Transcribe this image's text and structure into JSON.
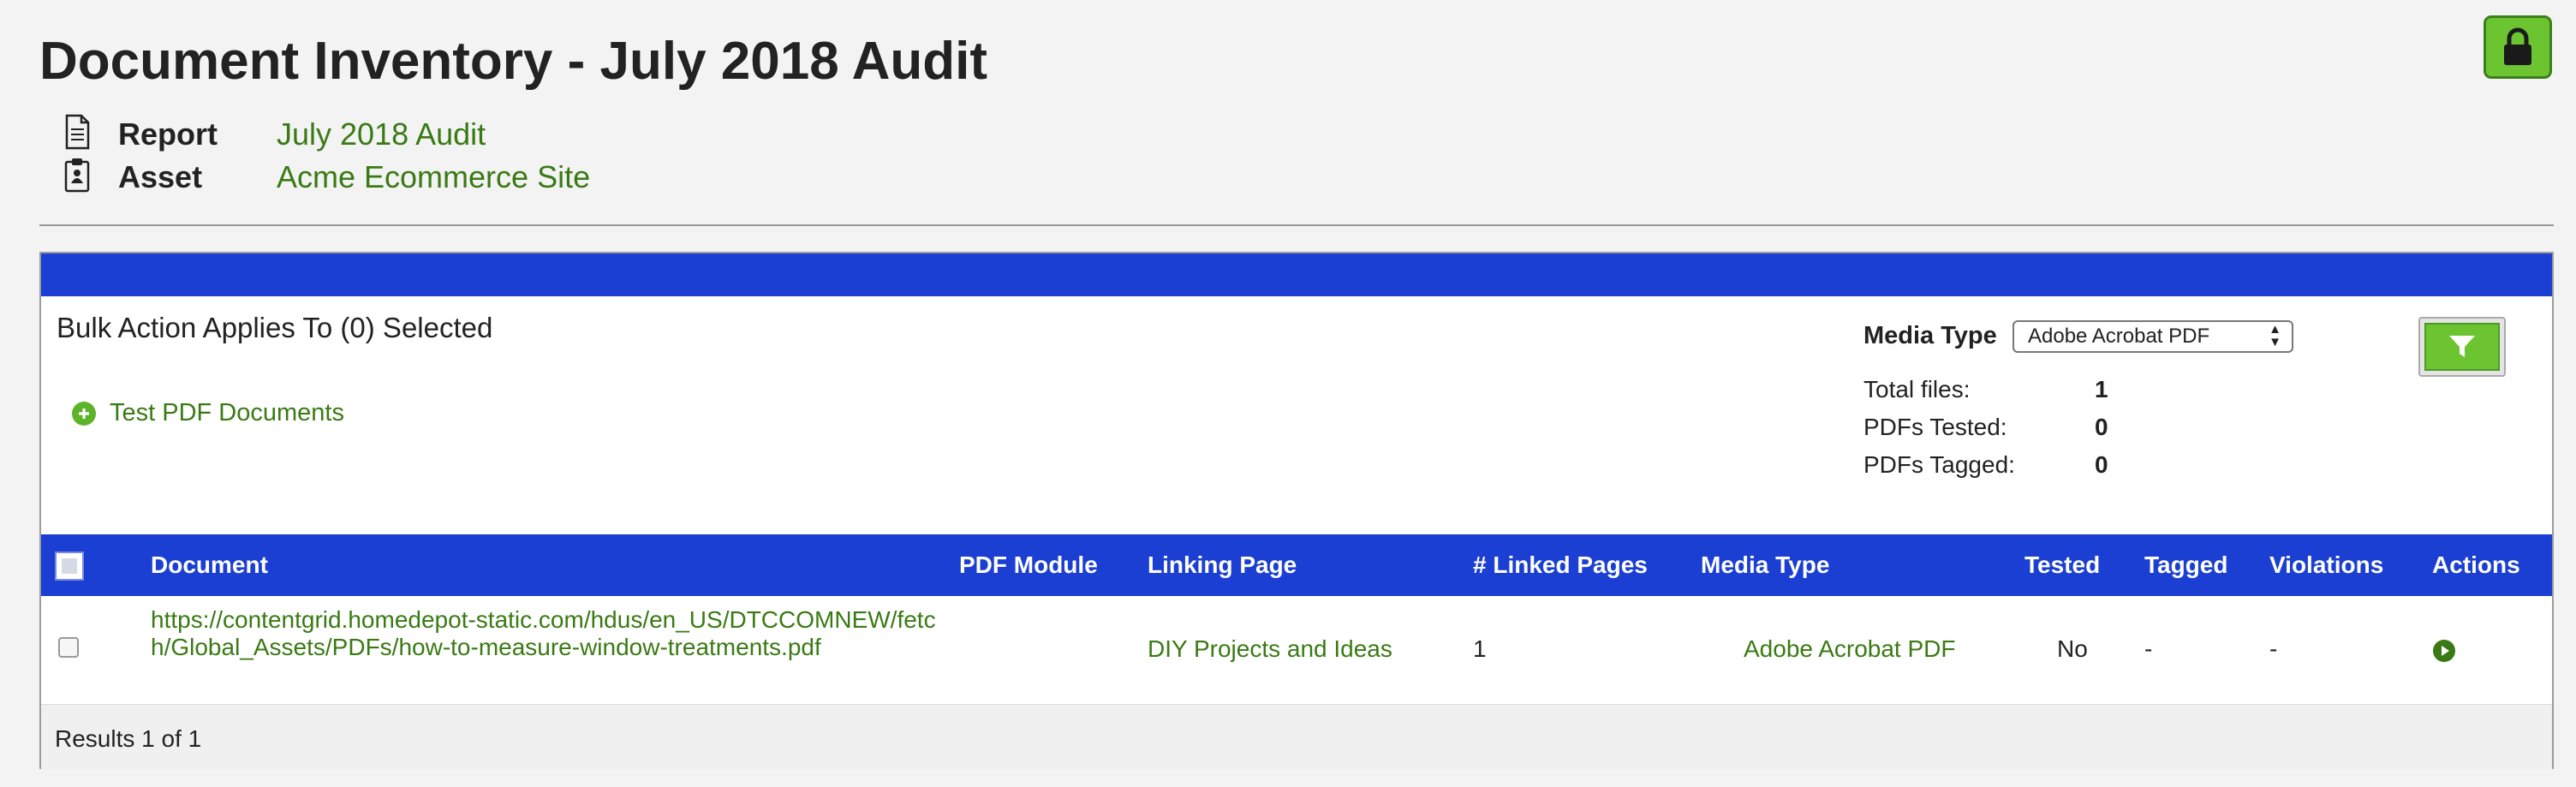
{
  "page": {
    "title": "Document Inventory - July 2018 Audit",
    "report_label": "Report",
    "report_value": "July 2018 Audit",
    "asset_label": "Asset",
    "asset_value": "Acme Ecommerce Site",
    "lock_icon": "lock-icon"
  },
  "toolbar": {
    "bulk_action_text": "Bulk Action Applies To (0) Selected",
    "test_pdf_label": "Test PDF Documents",
    "media_type_label": "Media Type",
    "media_type_selected": "Adobe Acrobat PDF",
    "filter_icon": "filter-icon"
  },
  "stats": {
    "total_files_label": "Total files:",
    "total_files_value": "1",
    "pdfs_tested_label": "PDFs Tested:",
    "pdfs_tested_value": "0",
    "pdfs_tagged_label": "PDFs Tagged:",
    "pdfs_tagged_value": "0"
  },
  "table": {
    "headers": {
      "document": "Document",
      "pdf_module": "PDF Module",
      "linking_page": "Linking Page",
      "linked_pages": "# Linked Pages",
      "media_type": "Media Type",
      "tested": "Tested",
      "tagged": "Tagged",
      "violations": "Violations",
      "actions": "Actions"
    },
    "rows": [
      {
        "document": "https://contentgrid.homedepot-static.com/hdus/en_US/DTCCOMNEW/fetch/Global_Assets/PDFs/how-to-measure-window-treatments.pdf",
        "pdf_module": "",
        "linking_page": "DIY Projects and Ideas",
        "linked_pages": "1",
        "media_type": "Adobe Acrobat PDF",
        "tested": "No",
        "tagged": "-",
        "violations": "-",
        "action_icon": "play-icon"
      }
    ],
    "results_text": "Results 1 of 1"
  },
  "colors": {
    "brand_blue": "#1b3fd3",
    "accent_green": "#6cc530",
    "link_green": "#3a7a14"
  }
}
